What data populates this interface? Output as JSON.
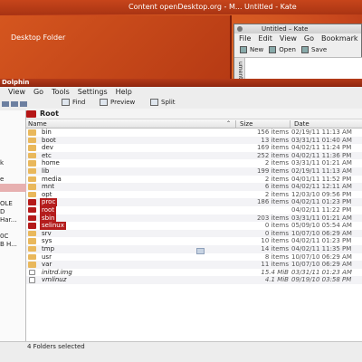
{
  "background": {
    "title_text": "Content openDesktop.org - M... Untitled - Kate",
    "desktop_folder_label": "Desktop Folder"
  },
  "kate": {
    "title": "Untitled – Kate",
    "menu": [
      "File",
      "Edit",
      "View",
      "Go",
      "Bookmark"
    ],
    "toolbar": {
      "new": "New",
      "open": "Open",
      "save": "Save"
    },
    "side_tab": "uments"
  },
  "dolphin": {
    "title": "Dolphin",
    "menu": [
      "View",
      "Go",
      "Tools",
      "Settings",
      "Help"
    ],
    "toolbar": {
      "find": "Find",
      "preview": "Preview",
      "split": "Split"
    },
    "places": [
      "k",
      "e",
      "OLE",
      "D",
      "Har...",
      "0C",
      "B H..."
    ],
    "breadcrumb": "Root",
    "columns": {
      "name": "Name",
      "size": "Size",
      "date": "Date"
    },
    "files": [
      {
        "name": "bin",
        "size": "156 items",
        "date": "02/19/11 11:13 AM",
        "kind": "folder"
      },
      {
        "name": "boot",
        "size": "13 items",
        "date": "03/31/11 01:40 AM",
        "kind": "folder"
      },
      {
        "name": "dev",
        "size": "169 items",
        "date": "04/02/11 11:24 PM",
        "kind": "folder"
      },
      {
        "name": "etc",
        "size": "252 items",
        "date": "04/02/11 11:36 PM",
        "kind": "folder"
      },
      {
        "name": "home",
        "size": "2 items",
        "date": "03/31/11 01:21 AM",
        "kind": "folder"
      },
      {
        "name": "lib",
        "size": "199 items",
        "date": "02/19/11 11:13 AM",
        "kind": "folder"
      },
      {
        "name": "media",
        "size": "2 items",
        "date": "04/01/11 11:52 PM",
        "kind": "folder"
      },
      {
        "name": "mnt",
        "size": "6 items",
        "date": "04/02/11 12:11 AM",
        "kind": "folder"
      },
      {
        "name": "opt",
        "size": "2 items",
        "date": "12/03/10 09:56 PM",
        "kind": "folder"
      },
      {
        "name": "proc",
        "size": "186 items",
        "date": "04/02/11 01:23 PM",
        "kind": "folder",
        "highlighted": true
      },
      {
        "name": "root",
        "size": "",
        "date": "04/02/11 11:22 PM",
        "kind": "folder",
        "highlighted": true
      },
      {
        "name": "sbin",
        "size": "203 items",
        "date": "03/31/11 01:21 AM",
        "kind": "folder",
        "highlighted": true
      },
      {
        "name": "selinux",
        "size": "0 items",
        "date": "05/09/10 05:54 AM",
        "kind": "folder",
        "highlighted": true
      },
      {
        "name": "srv",
        "size": "0 items",
        "date": "10/07/10 06:29 AM",
        "kind": "folder"
      },
      {
        "name": "sys",
        "size": "10 items",
        "date": "04/02/11 01:23 PM",
        "kind": "folder"
      },
      {
        "name": "tmp",
        "size": "14 items",
        "date": "04/02/11 11:35 PM",
        "kind": "folder"
      },
      {
        "name": "usr",
        "size": "8 items",
        "date": "10/07/10 06:29 AM",
        "kind": "folder"
      },
      {
        "name": "var",
        "size": "11 items",
        "date": "10/07/10 06:29 AM",
        "kind": "folder"
      },
      {
        "name": "initrd.img",
        "size": "15.4 MiB",
        "date": "03/31/11 01:23 AM",
        "kind": "link"
      },
      {
        "name": "vmlinuz",
        "size": "4.1 MiB",
        "date": "09/19/10 03:58 PM",
        "kind": "link"
      }
    ],
    "status": "4 Folders selected"
  },
  "colors": {
    "accent": "#b41d1d",
    "desktop": "#c9481d"
  }
}
